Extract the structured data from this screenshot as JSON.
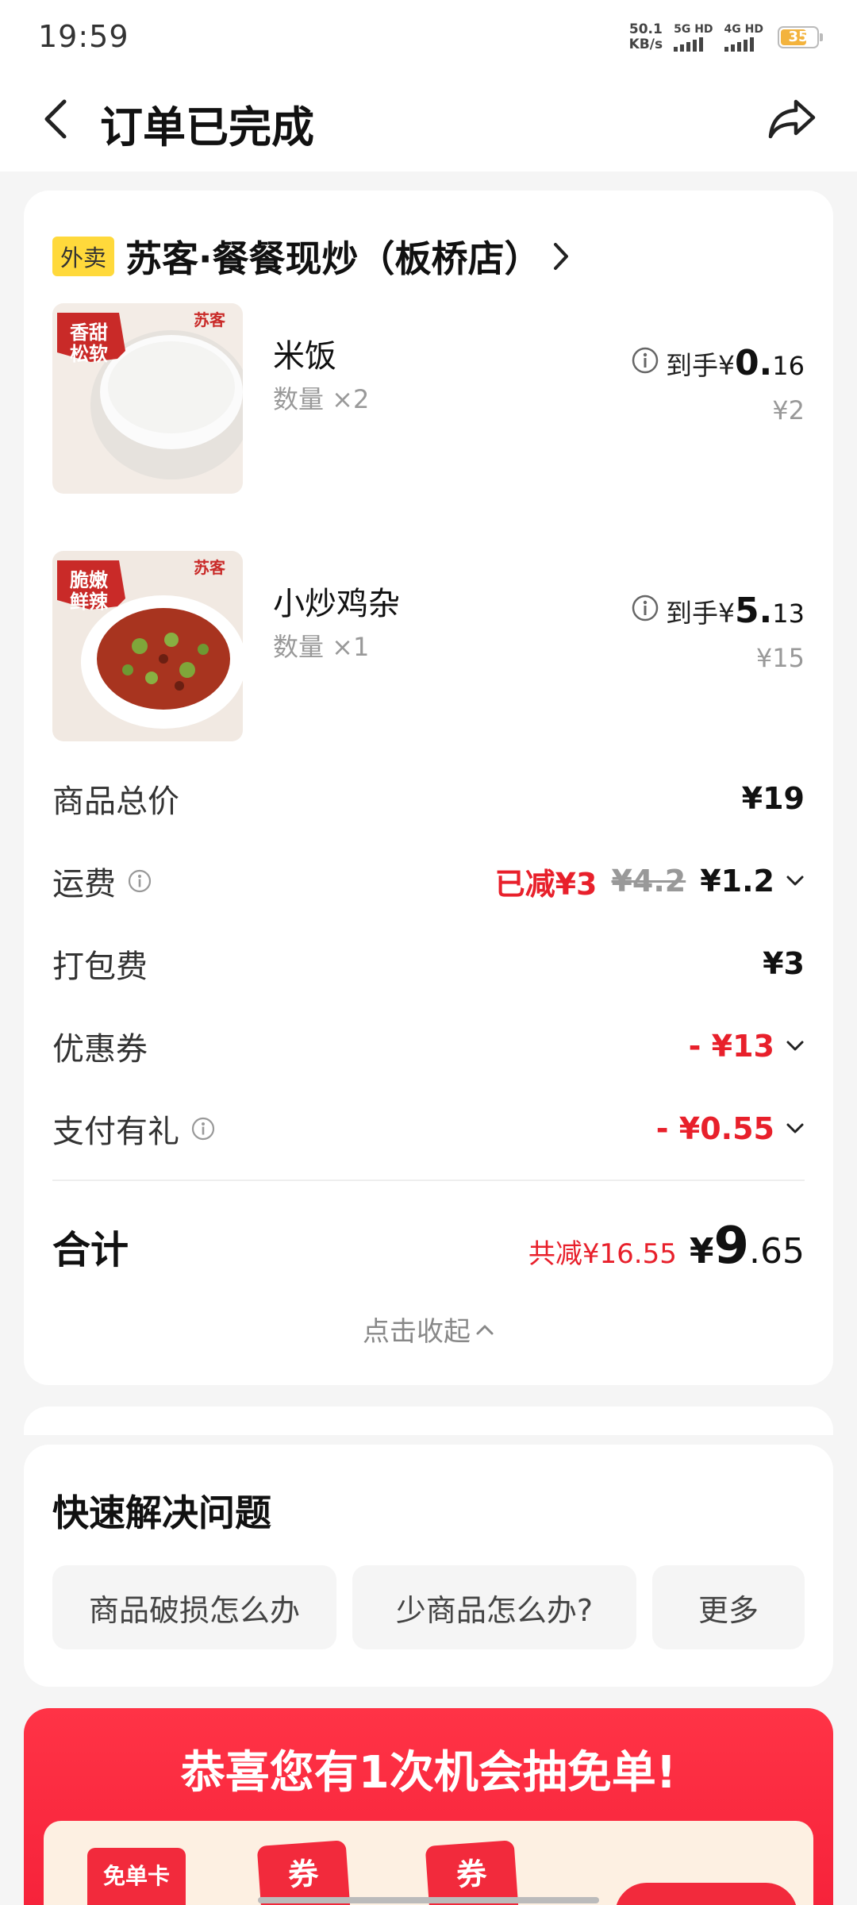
{
  "status_bar": {
    "time": "19:59",
    "net_speed_value": "50.1",
    "net_speed_unit": "KB/s",
    "sig1": "5G HD",
    "sig2": "4G HD",
    "battery": "35"
  },
  "nav": {
    "title": "订单已完成"
  },
  "store": {
    "tag": "外卖",
    "name": "苏客·餐餐现炒（板桥店）"
  },
  "items": [
    {
      "name": "米饭",
      "qty": "数量 ×2",
      "price_label": "到手¥",
      "price_int": "0.",
      "price_dec": "16",
      "orig": "¥2",
      "badge_line1": "香甜",
      "badge_line2": "松软",
      "brand": "苏客"
    },
    {
      "name": "小炒鸡杂",
      "qty": "数量 ×1",
      "price_label": "到手¥",
      "price_int": "5.",
      "price_dec": "13",
      "orig": "¥15",
      "badge_line1": "脆嫩",
      "badge_line2": "鲜辣",
      "brand": "苏客"
    }
  ],
  "fees": {
    "goods_total": {
      "label": "商品总价",
      "value": "¥19"
    },
    "delivery": {
      "label": "运费",
      "discount": "已减¥3",
      "original": "¥4.2",
      "value": "¥1.2"
    },
    "packing": {
      "label": "打包费",
      "value": "¥3"
    },
    "coupon": {
      "label": "优惠券",
      "value": "- ¥13"
    },
    "pay_gift": {
      "label": "支付有礼",
      "value": "- ¥0.55"
    }
  },
  "total": {
    "label": "合计",
    "saved": "共减¥16.55",
    "yen": "¥",
    "int": "9",
    "dec": ".65",
    "collapse": "点击收起"
  },
  "quick": {
    "title": "快速解决问题",
    "chips": [
      "商品破损怎么办",
      "少商品怎么办?",
      "更多"
    ]
  },
  "promo": {
    "title": "恭喜您有1次机会抽免单!",
    "free_card": "免单卡",
    "coupon_label": "券"
  },
  "colors": {
    "accent_red": "#e8202b",
    "tag_yellow": "#ffd93b",
    "promo_red": "#f6223a"
  }
}
